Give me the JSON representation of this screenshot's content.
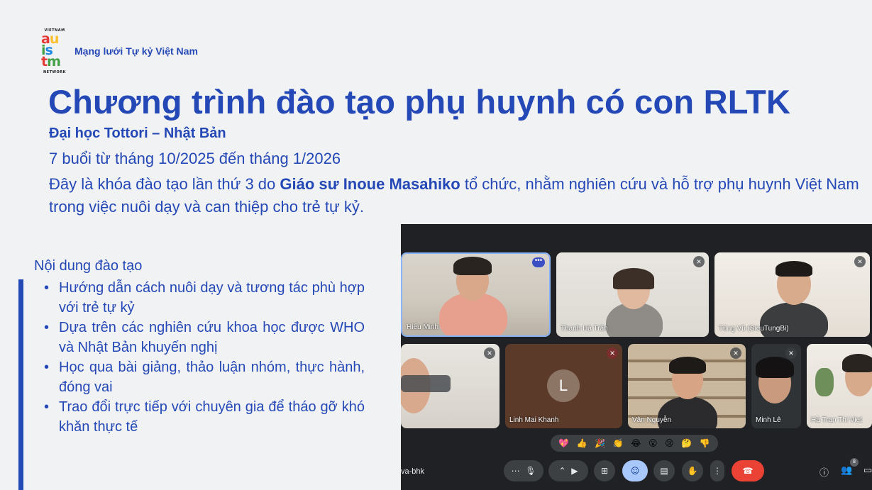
{
  "brand": {
    "logo_top": "VIETNAM",
    "logo_rows": [
      [
        "a",
        "#e53935"
      ],
      [
        "u",
        "#fbc02d"
      ],
      [
        "i",
        "#43a047"
      ],
      [
        "s",
        "#1e88e5"
      ],
      [
        "t",
        "#e53935"
      ],
      [
        "m",
        "#43a047"
      ]
    ],
    "logo_bottom": "NETWORK",
    "name": "Mạng lưới Tự kỷ Việt Nam"
  },
  "slide": {
    "title": "Chương trình đào tạo phụ huynh có con RLTK",
    "subtitle": "Đại học Tottori – Nhật Bản",
    "dates": "7 buổi từ tháng 10/2025 đến tháng 1/2026",
    "desc_before": "Đây là khóa đào tạo lần thứ 3 do ",
    "desc_bold": "Giáo sư Inoue Masahiko",
    "desc_after": " tổ chức, nhằm nghiên cứu và hỗ trợ phụ huynh Việt Nam trong việc nuôi dạy và can thiệp cho trẻ tự kỷ.",
    "content_heading": "Nội dung đào tạo",
    "content_items": [
      "Hướng dẫn cách nuôi dạy và tương tác phù hợp với trẻ tự kỷ",
      "Dựa trên các nghiên cứu khoa học được WHO và Nhật Bản khuyến nghị",
      "Học qua bài giảng, thảo luận nhóm, thực hành, đóng vai",
      "Trao đổi trực tiếp với chuyên gia để tháo gỡ khó khăn thực tế"
    ]
  },
  "meeting": {
    "participants": [
      {
        "name": "Hiếu Minh"
      },
      {
        "name": "Thanh Hà Trần"
      },
      {
        "name": "Tùng Vũ (SieuTungBi)"
      },
      {
        "name": ""
      },
      {
        "name": "Linh Mai Khanh",
        "initial": "L"
      },
      {
        "name": "Vân Nguyễn"
      },
      {
        "name": "Minh Lê"
      },
      {
        "name": "Hà Tran Thi Viet"
      }
    ],
    "reactions": [
      "💖",
      "👍",
      "🎉",
      "👏",
      "😂",
      "😮",
      "😢",
      "🤔",
      "👎"
    ],
    "meeting_code": "va-bhk",
    "participant_count": "8",
    "colors": {
      "panel_bg": "#202124",
      "hangup": "#ea4335",
      "active": "#a8c7fa"
    }
  }
}
